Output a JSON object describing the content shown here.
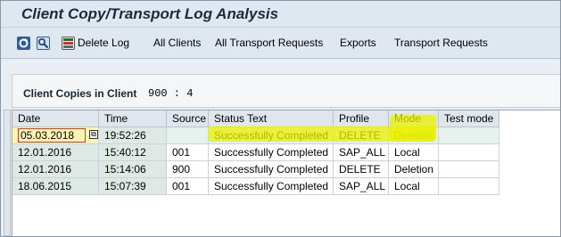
{
  "window": {
    "title": "Client Copy/Transport Log Analysis"
  },
  "toolbar": {
    "delete_log": "Delete Log",
    "all_clients": "All Clients",
    "all_transport_requests": "All Transport Requests",
    "exports": "Exports",
    "transport_requests": "Transport Requests",
    "icons": [
      "refresh-icon",
      "find-icon",
      "delete-log-icon"
    ]
  },
  "section": {
    "label": "Client Copies in Client",
    "value": "900 : 4"
  },
  "grid": {
    "columns": [
      "Date",
      "Time",
      "Source",
      "Status Text",
      "Profile",
      "Mode",
      "Test mode"
    ],
    "rows": [
      [
        "05.03.2018",
        "19:52:26",
        "",
        "Successfully Completed",
        "DELETE",
        "Deletion",
        ""
      ],
      [
        "12.01.2016",
        "15:40:12",
        "001",
        "Successfully Completed",
        "SAP_ALL",
        "Local",
        ""
      ],
      [
        "12.01.2016",
        "15:14:06",
        "900",
        "Successfully Completed",
        "DELETE",
        "Deletion",
        ""
      ],
      [
        "18.06.2015",
        "15:07:39",
        "001",
        "Successfully Completed",
        "SAP_ALL",
        "Local",
        ""
      ]
    ]
  },
  "colors": {
    "highlight": "#ebf000",
    "row_selected": "#e7f2ec",
    "date_input_bg": "#fff4b3",
    "date_input_border": "#cc3333"
  }
}
